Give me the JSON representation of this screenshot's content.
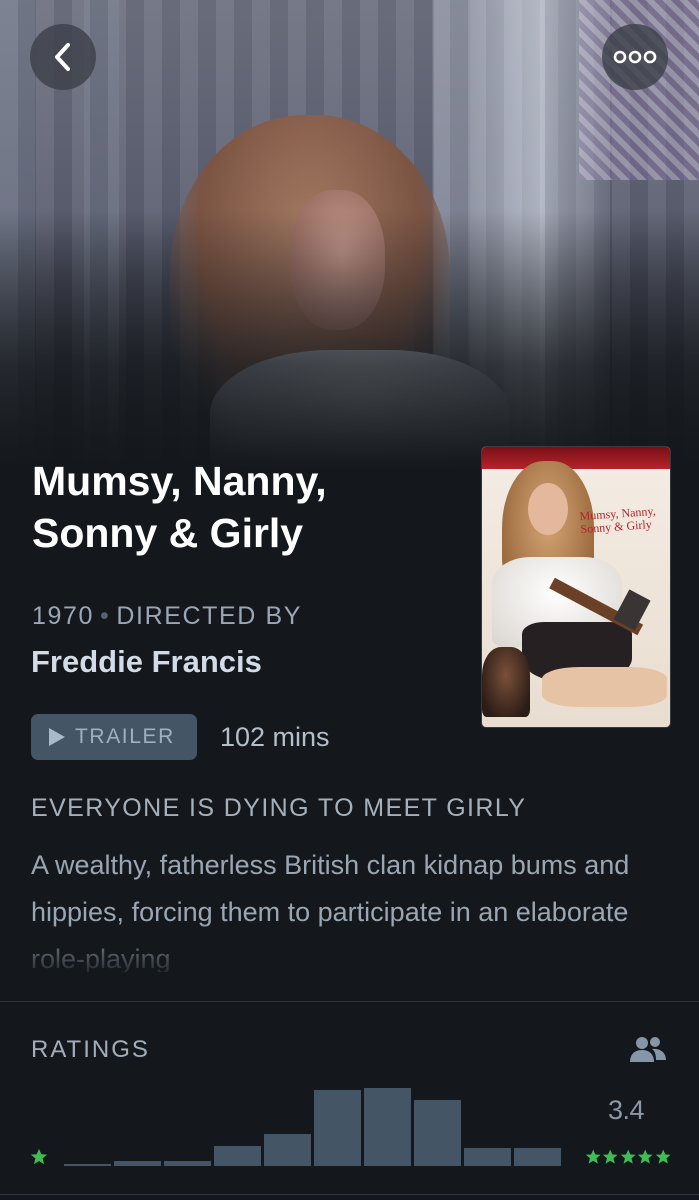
{
  "film": {
    "title": "Mumsy, Nanny, Sonny & Girly",
    "year": "1970",
    "separator": "•",
    "directed_by_label": "DIRECTED BY",
    "director": "Freddie Francis",
    "trailer_label": "TRAILER",
    "runtime": "102 mins",
    "tagline": "EVERYONE IS DYING TO MEET GIRLY",
    "synopsis": "A wealthy, fatherless British clan kidnap bums and hippies, forcing them to participate in an elaborate role-playing",
    "poster_title": "Mumsy, Nanny, Sonny & Girly"
  },
  "nav": {
    "back_icon": "chevron-left-icon",
    "more_icon": "ellipsis-icon"
  },
  "ratings": {
    "label": "RATINGS",
    "average": "3.4",
    "histogram_share_of_tallest": [
      0.03,
      0.07,
      0.07,
      0.26,
      0.41,
      0.97,
      1.0,
      0.85,
      0.23,
      0.23
    ],
    "bar_color": "#445566",
    "star_color": "#40bc55"
  },
  "colors": {
    "background": "#14181c",
    "button_bg": "#445566",
    "muted_text": "#9ba7b6"
  }
}
